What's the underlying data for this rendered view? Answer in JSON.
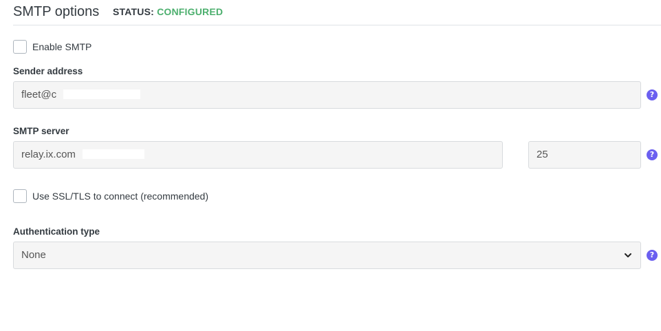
{
  "header": {
    "title": "SMTP options",
    "status_label": "STATUS:",
    "status_value": "CONFIGURED"
  },
  "enable_smtp": {
    "label": "Enable SMTP",
    "checked": false
  },
  "sender": {
    "label": "Sender address",
    "value": "fleet@c",
    "help_icon": "question-circle-icon"
  },
  "smtp_server": {
    "label": "SMTP server",
    "value": "relay.ix.com",
    "port": "25",
    "help_icon": "question-circle-icon"
  },
  "ssl": {
    "label": "Use SSL/TLS to connect (recommended)",
    "checked": false
  },
  "auth": {
    "label": "Authentication type",
    "selected": "None",
    "help_icon": "question-circle-icon"
  },
  "colors": {
    "status_ok": "#4caf6e",
    "help_icon": "#6b5ff0",
    "input_bg": "#f5f5f5"
  }
}
